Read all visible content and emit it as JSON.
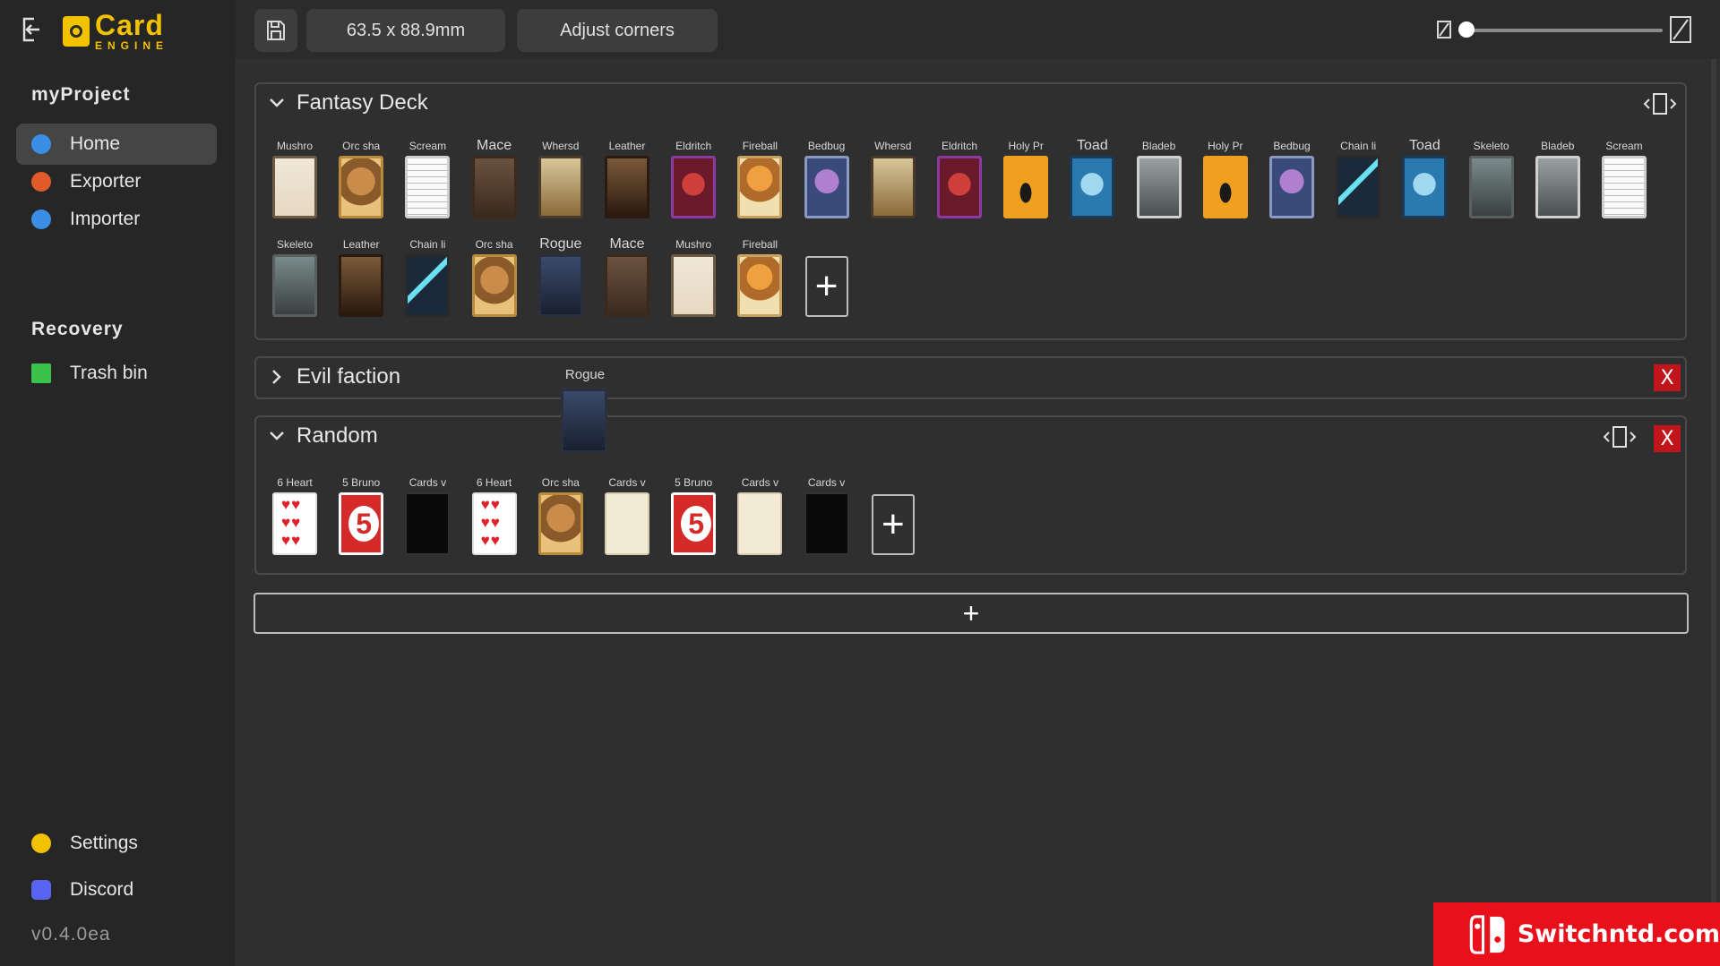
{
  "app": {
    "logo_title": "Card",
    "logo_subtitle": "ENGINE",
    "card_size": "63.5 x 88.9mm",
    "adjust_corners": "Adjust corners",
    "version": "v0.4.0ea"
  },
  "sidebar": {
    "project": "myProject",
    "nav": [
      {
        "label": "Home",
        "icon": "home-icon",
        "color": "#3a8ee6",
        "active": true
      },
      {
        "label": "Exporter",
        "icon": "exporter-icon",
        "color": "#e05a2a"
      },
      {
        "label": "Importer",
        "icon": "importer-icon",
        "color": "#3a8ee6"
      }
    ],
    "recovery_title": "Recovery",
    "trash": {
      "label": "Trash bin",
      "icon": "trash-icon",
      "color": "#3ac24a"
    },
    "settings": {
      "label": "Settings",
      "icon": "gear-icon",
      "color": "#f2c200"
    },
    "discord": {
      "label": "Discord",
      "icon": "discord-icon",
      "color": "#5865f2"
    }
  },
  "zoom": {
    "level": 0
  },
  "decks": [
    {
      "title": "Fantasy Deck",
      "expanded": true,
      "cards": [
        {
          "name": "Mushro",
          "art": "mushroom"
        },
        {
          "name": "Orc sha",
          "art": "orc"
        },
        {
          "name": "Scream",
          "art": "scream"
        },
        {
          "name": "Mace",
          "art": "mace",
          "big": true
        },
        {
          "name": "Whersd",
          "art": "whersd"
        },
        {
          "name": "Leather",
          "art": "leather"
        },
        {
          "name": "Eldritch",
          "art": "eldritch"
        },
        {
          "name": "Fireball",
          "art": "fireball"
        },
        {
          "name": "Bedbug",
          "art": "bedbug"
        },
        {
          "name": "Whersd",
          "art": "whersd"
        },
        {
          "name": "Eldritch",
          "art": "eldritch"
        },
        {
          "name": "Holy Pr",
          "art": "holy"
        },
        {
          "name": "Toad",
          "art": "toad",
          "big": true
        },
        {
          "name": "Bladeb",
          "art": "bladeb"
        },
        {
          "name": "Holy Pr",
          "art": "holy"
        },
        {
          "name": "Bedbug",
          "art": "bedbug"
        },
        {
          "name": "Chain li",
          "art": "chain"
        },
        {
          "name": "Toad",
          "art": "toad",
          "big": true
        },
        {
          "name": "Skeleto",
          "art": "skeleton"
        },
        {
          "name": "Bladeb",
          "art": "bladeb"
        },
        {
          "name": "Scream",
          "art": "scream"
        },
        {
          "name": "Skeleto",
          "art": "skeleton"
        },
        {
          "name": "Leather",
          "art": "leather"
        },
        {
          "name": "Chain li",
          "art": "chain"
        },
        {
          "name": "Orc sha",
          "art": "orc"
        },
        {
          "name": "Rogue",
          "art": "rogue",
          "big": true
        },
        {
          "name": "Mace",
          "art": "mace",
          "big": true
        },
        {
          "name": "Mushro",
          "art": "mushroom"
        },
        {
          "name": "Fireball",
          "art": "fireball"
        }
      ]
    },
    {
      "title": "Evil faction",
      "expanded": false,
      "cards": []
    },
    {
      "title": "Random",
      "expanded": true,
      "cards": [
        {
          "name": "6 Heart",
          "art": "heart"
        },
        {
          "name": "5 Bruno",
          "art": "bruno"
        },
        {
          "name": "Cards v",
          "art": "cards-black"
        },
        {
          "name": "6 Heart",
          "art": "heart"
        },
        {
          "name": "Orc sha",
          "art": "orc"
        },
        {
          "name": "Cards v",
          "art": "cards-cream"
        },
        {
          "name": "5 Bruno",
          "art": "bruno"
        },
        {
          "name": "Cards v",
          "art": "cards-cream"
        },
        {
          "name": "Cards v",
          "art": "cards-black"
        }
      ]
    }
  ],
  "dragging": {
    "name": "Rogue",
    "art": "rogue"
  },
  "add_symbol": "+",
  "close_symbol": "X",
  "watermark": {
    "text": "Switchntd.com"
  }
}
